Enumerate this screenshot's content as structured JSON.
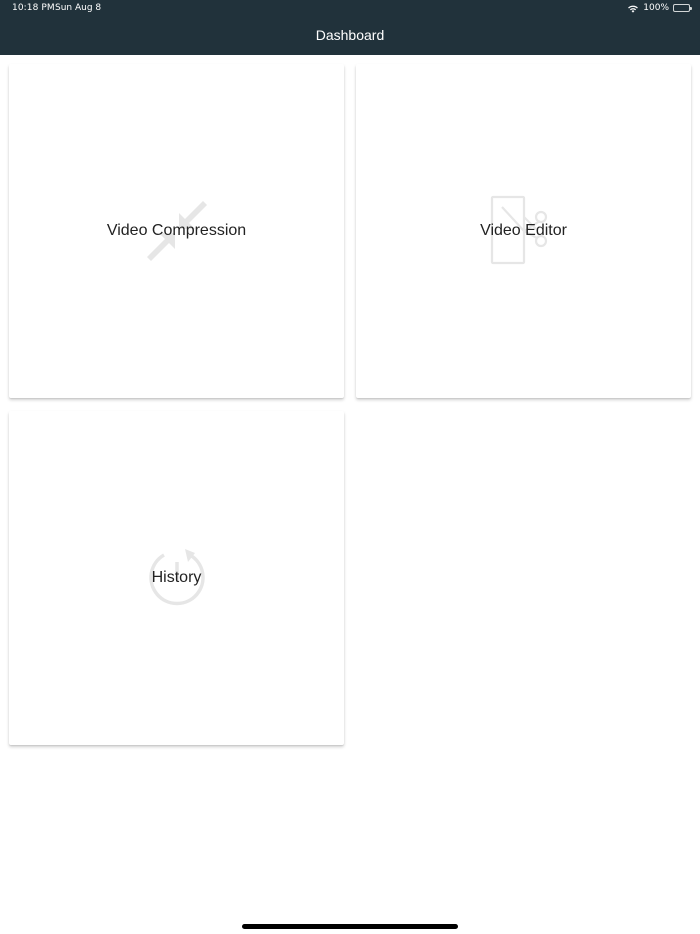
{
  "status_bar": {
    "time": "10:18 PM",
    "date": "Sun Aug 8",
    "battery_percent": "100%",
    "battery_level": 1.0,
    "wifi_icon": "wifi-icon",
    "battery_icon": "battery-icon"
  },
  "nav": {
    "title": "Dashboard"
  },
  "cards": [
    {
      "label": "Video Compression",
      "icon": "compress-arrows-icon"
    },
    {
      "label": "Video Editor",
      "icon": "video-edit-scissors-icon"
    },
    {
      "label": "History",
      "icon": "history-clock-icon"
    }
  ],
  "colors": {
    "nav_background": "#21323b",
    "icon_tint": "#e6e6e6",
    "label_text": "#222222"
  }
}
